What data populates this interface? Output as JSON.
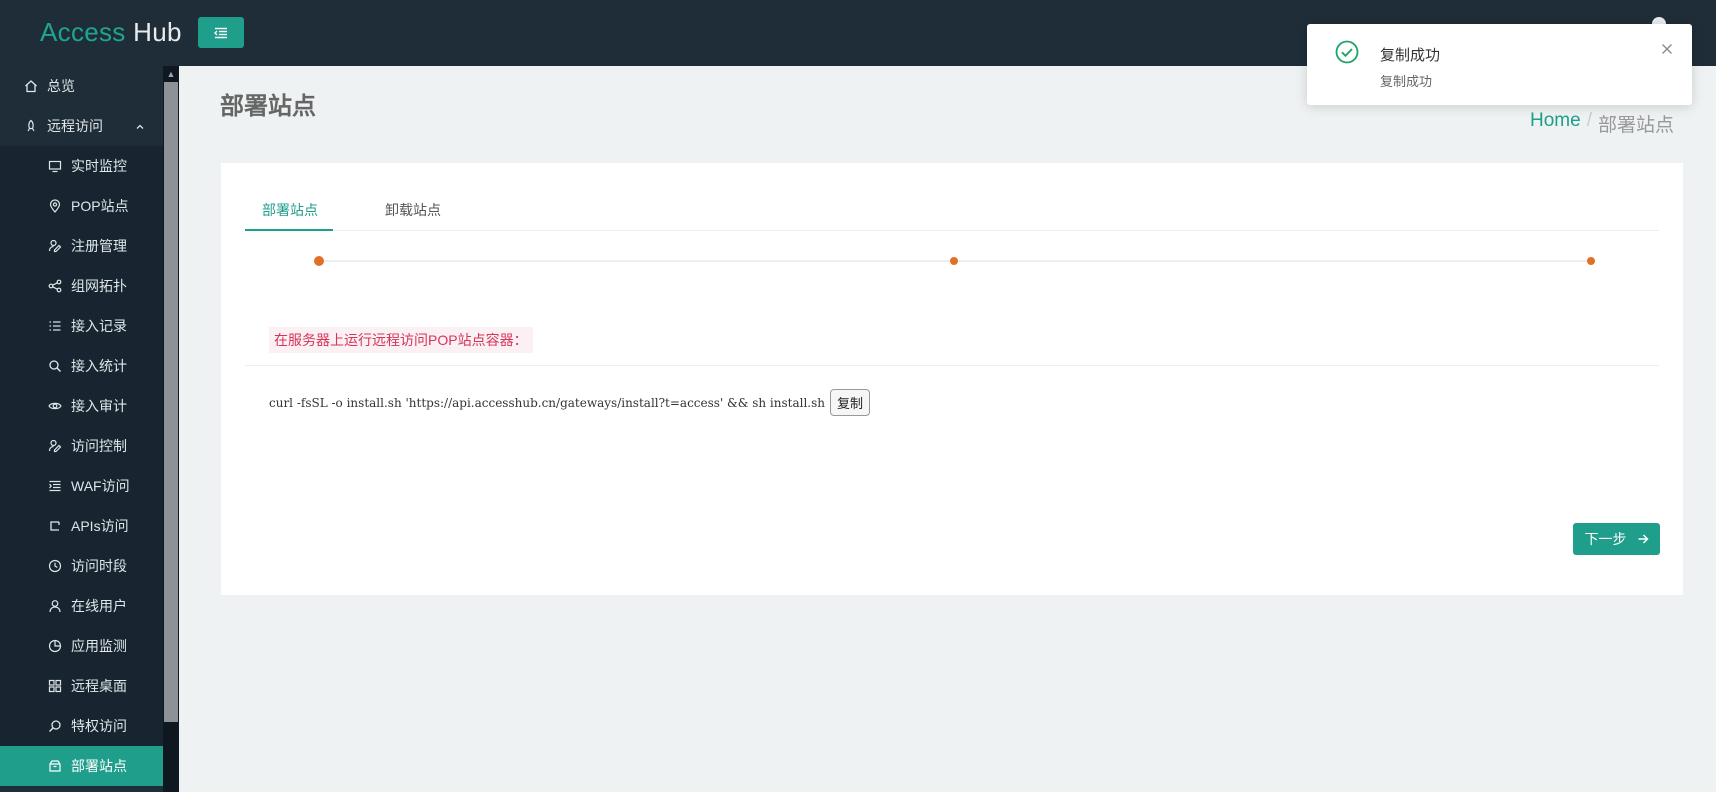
{
  "header": {
    "logo_access": "Access",
    "logo_hub": "Hub"
  },
  "sidebar": {
    "items": [
      {
        "label": "总览",
        "icon": "home-icon"
      },
      {
        "label": "远程访问",
        "icon": "rocket-icon",
        "expanded": true
      },
      {
        "label": "实时监控",
        "icon": "monitor-icon"
      },
      {
        "label": "POP站点",
        "icon": "map-pin-icon"
      },
      {
        "label": "注册管理",
        "icon": "user-edit-icon"
      },
      {
        "label": "组网拓扑",
        "icon": "share-icon"
      },
      {
        "label": "接入记录",
        "icon": "list-icon"
      },
      {
        "label": "接入统计",
        "icon": "search-icon"
      },
      {
        "label": "接入审计",
        "icon": "eye-icon"
      },
      {
        "label": "访问控制",
        "icon": "user-edit-icon"
      },
      {
        "label": "WAF访问",
        "icon": "indent-icon"
      },
      {
        "label": "APIs访问",
        "icon": "bracket-icon"
      },
      {
        "label": "访问时段",
        "icon": "clock-icon"
      },
      {
        "label": "在线用户",
        "icon": "user-icon"
      },
      {
        "label": "应用监测",
        "icon": "pie-chart-icon"
      },
      {
        "label": "远程桌面",
        "icon": "grid-icon"
      },
      {
        "label": "特权访问",
        "icon": "key-search-icon"
      },
      {
        "label": "部署站点",
        "icon": "box-icon",
        "active": true
      }
    ]
  },
  "page": {
    "title": "部署站点",
    "breadcrumb_home": "Home",
    "breadcrumb_sep": "/",
    "breadcrumb_current": "部署站点"
  },
  "tabs": [
    {
      "label": "部署站点",
      "active": true
    },
    {
      "label": "卸载站点",
      "active": false
    }
  ],
  "steps": {
    "count": 3
  },
  "content": {
    "cmd_label": "在服务器上运行远程访问POP站点容器：",
    "command": "curl -fsSL -o install.sh 'https://api.accesshub.cn/gateways/install?t=access' && sh install.sh",
    "copy_label": "复制",
    "next_label": "下一步"
  },
  "toast": {
    "title": "复制成功",
    "message": "复制成功"
  },
  "colors": {
    "accent": "#1f9e8c",
    "sidebar_bg": "#1f2d38",
    "step_dot": "#e07228",
    "label_text": "#d7345a",
    "success": "#1fa266"
  }
}
